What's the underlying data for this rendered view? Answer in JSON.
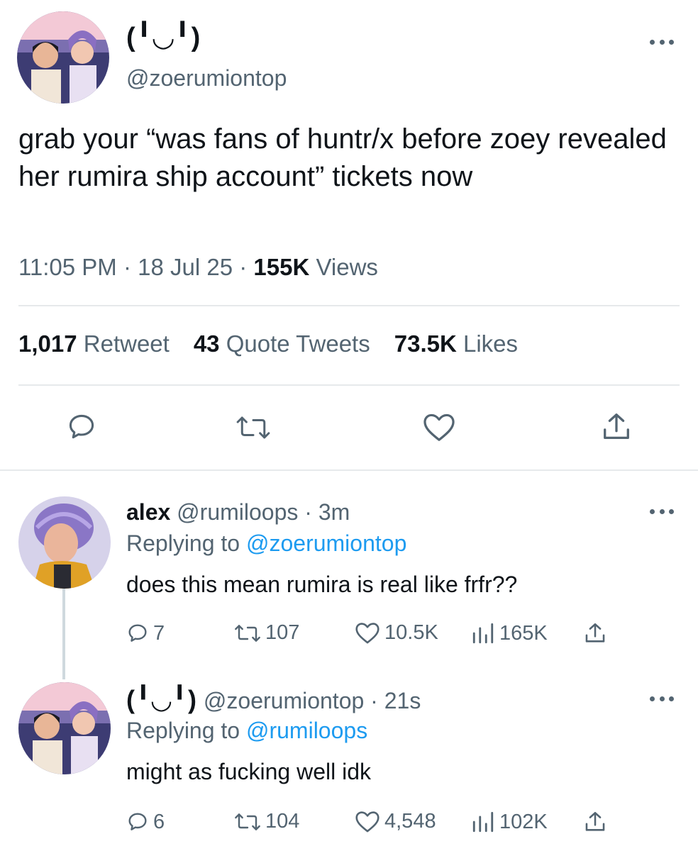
{
  "tweet": {
    "author_name": "(╹◡╹)",
    "author_handle": "@zoerumiontop",
    "text": "grab your “was fans of huntr/x before zoey revealed her rumira ship account” tickets now",
    "time": "11:05 PM",
    "sep1": " · ",
    "date": "18 Jul 25",
    "sep2": " · ",
    "views_count": "155K",
    "views_label": " Views",
    "retweets_count": "1,017",
    "retweets_label": " Retweet",
    "quotes_count": "43",
    "quotes_label": " Quote Tweets",
    "likes_count": "73.5K",
    "likes_label": " Likes"
  },
  "replies": [
    {
      "name": "alex",
      "handle": "@rumiloops",
      "sep": " · ",
      "time": "3m",
      "replying_label": "Replying to ",
      "replying_handle": "@zoerumiontop",
      "text": "does this mean rumira is real like frfr??",
      "reply_count": "7",
      "retweet_count": "107",
      "like_count": "10.5K",
      "views_count": "165K"
    },
    {
      "name": "(╹◡╹)",
      "handle": "@zoerumiontop",
      "sep": " · ",
      "time": "21s",
      "replying_label": "Replying to ",
      "replying_handle": "@rumiloops",
      "text": "might as fucking well idk",
      "reply_count": "6",
      "retweet_count": "104",
      "like_count": "4,548",
      "views_count": "102K"
    }
  ],
  "icons": {
    "more": "more-horizontal-icon",
    "reply": "speech-bubble-icon",
    "retweet": "retweet-icon",
    "like": "heart-icon",
    "share": "share-icon",
    "views": "bar-chart-icon"
  },
  "colors": {
    "text": "#0f1419",
    "secondary": "#536471",
    "link": "#1d9bf0",
    "divider": "#e6e9eb"
  }
}
